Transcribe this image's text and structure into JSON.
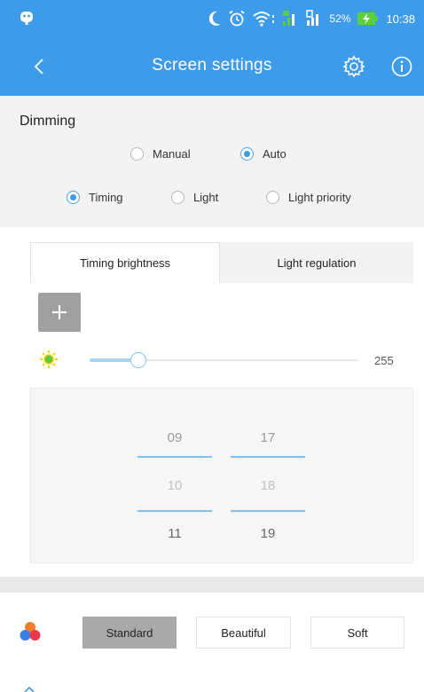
{
  "status_bar": {
    "battery_percent": "52%",
    "time": "10:38",
    "icons": [
      "robot-icon",
      "moon-icon",
      "alarm-icon",
      "wifi-icon",
      "signal-icon",
      "signal-icon",
      "battery-charging-icon"
    ]
  },
  "app_bar": {
    "title": "Screen settings",
    "icons": [
      "back-arrow-icon",
      "gear-icon",
      "info-icon"
    ],
    "color": "#3d9be9"
  },
  "dimming": {
    "label": "Dimming",
    "mode_options": [
      {
        "label": "Manual",
        "selected": false
      },
      {
        "label": "Auto",
        "selected": true
      }
    ],
    "source_options": [
      {
        "label": "Timing",
        "selected": true
      },
      {
        "label": "Light",
        "selected": false
      },
      {
        "label": "Light priority",
        "selected": false
      }
    ]
  },
  "tabs": [
    {
      "label": "Timing brightness",
      "active": true
    },
    {
      "label": "Light regulation",
      "active": false
    }
  ],
  "add_button": {
    "icon": "plus-icon"
  },
  "brightness": {
    "icon": "brightness-icon",
    "value_fraction": 0.18,
    "max_label": "255"
  },
  "time_picker": {
    "hours": [
      "09",
      "10",
      "11"
    ],
    "minutes": [
      "17",
      "18",
      "19"
    ]
  },
  "theme": {
    "icon": "palette-icon",
    "options": [
      {
        "label": "Standard",
        "selected": true
      },
      {
        "label": "Beautiful",
        "selected": false
      },
      {
        "label": "Soft",
        "selected": false
      }
    ]
  }
}
